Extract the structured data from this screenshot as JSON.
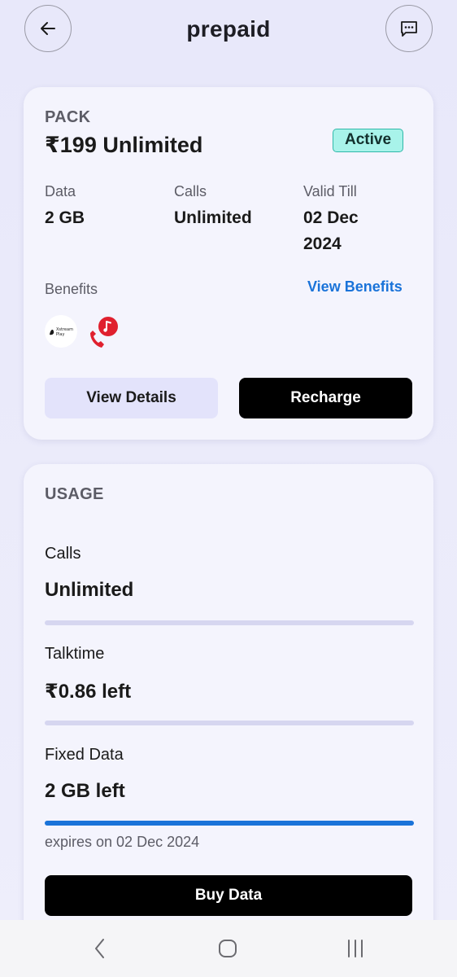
{
  "header": {
    "title": "prepaid",
    "back_icon": "arrow-left-icon",
    "chat_icon": "chat-bubble-icon"
  },
  "pack": {
    "section_label": "PACK",
    "name": "₹199 Unlimited",
    "status": "Active",
    "stats": [
      {
        "label": "Data",
        "value": "2 GB"
      },
      {
        "label": "Calls",
        "value": "Unlimited"
      },
      {
        "label": "Valid Till",
        "value_line1": "02 Dec",
        "value_line2": "2024"
      }
    ],
    "benefits_label": "Benefits",
    "view_benefits_label": "View Benefits",
    "benefit_icons": [
      "xstream-play-icon",
      "music-call-icon"
    ],
    "xstream_logo_text_1": "Xstream",
    "xstream_logo_text_2": "Play",
    "view_details_label": "View Details",
    "recharge_label": "Recharge"
  },
  "usage": {
    "section_label": "USAGE",
    "items": [
      {
        "label": "Calls",
        "value": "Unlimited",
        "progress": 0
      },
      {
        "label": "Talktime",
        "value": "₹0.86 left",
        "progress": 0
      },
      {
        "label": "Fixed Data",
        "value": "2 GB left",
        "progress": 1.0
      }
    ],
    "expires_text": "expires on 02 Dec 2024",
    "buy_data_label": "Buy Data"
  },
  "colors": {
    "accent": "#1a73d9",
    "active_badge_bg": "#a8f3ea",
    "active_badge_border": "#2fb8a9",
    "primary_button": "#000000",
    "secondary_button": "#e3e3fb",
    "music_icon_red": "#e0202e"
  },
  "navbar": {
    "icons": [
      "nav-back-icon",
      "nav-home-icon",
      "nav-recents-icon"
    ]
  }
}
